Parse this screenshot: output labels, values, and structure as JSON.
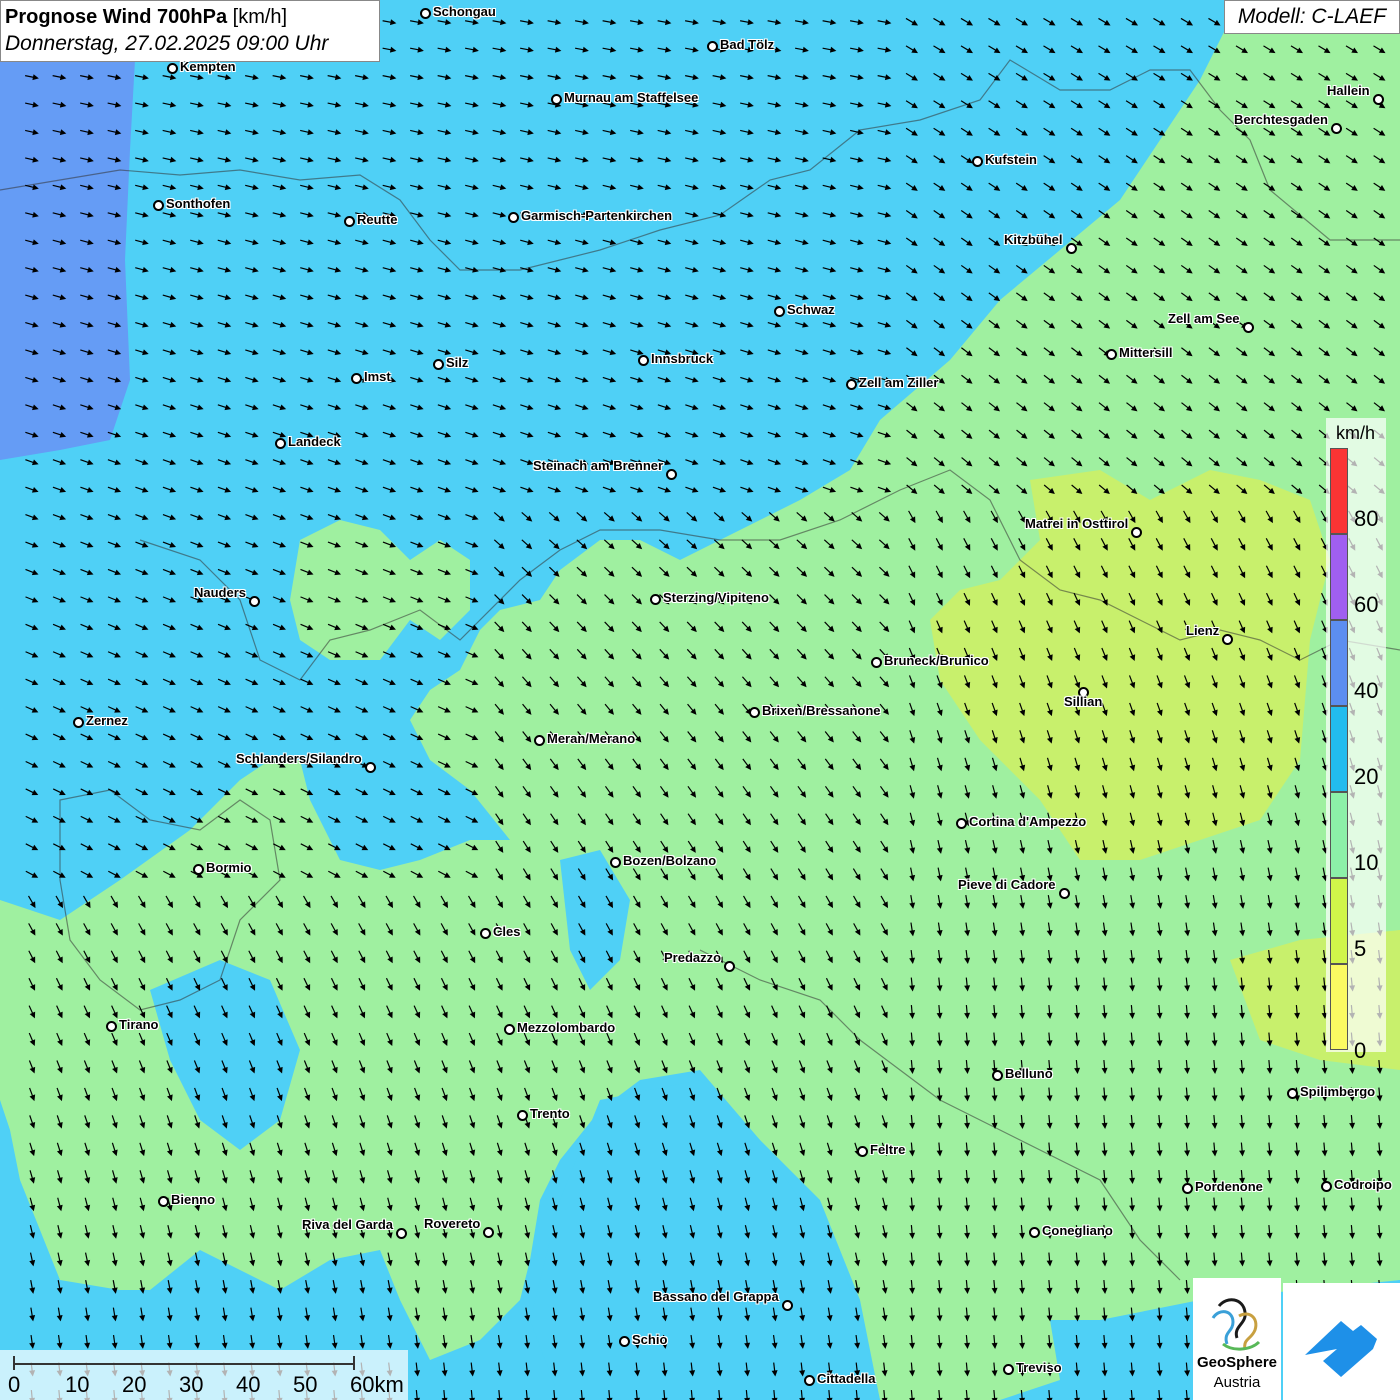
{
  "title": {
    "bold": "Prognose Wind 700hPa",
    "unit": "[km/h]",
    "datetime": "Donnerstag, 27.02.2025 09:00 Uhr"
  },
  "model": "Modell: C-LAEF",
  "legend": {
    "unit": "km/h",
    "ticks": [
      "80",
      "60",
      "40",
      "20",
      "10",
      "5",
      "0"
    ],
    "colors": [
      "#fa3434",
      "#a05ff0",
      "#5c8ef0",
      "#22bcee",
      "#8cf0a8",
      "#d0f54a",
      "#fafa62"
    ]
  },
  "scalebar": {
    "labels": [
      "0",
      "10",
      "20",
      "30",
      "40",
      "50",
      "60km"
    ]
  },
  "logo": {
    "name1": "GeoSphere",
    "name2": "Austria"
  },
  "colors": {
    "strong": "#4fd0f6",
    "medium": "#9ff0a0",
    "weak": "#c8f06c",
    "violet": "#6a8ef5"
  },
  "cities": [
    {
      "name": "Schongau"
    },
    {
      "name": "Bad Tölz"
    },
    {
      "name": "Kempten"
    },
    {
      "name": "Murnau am Staffelsee"
    },
    {
      "name": "Hallein"
    },
    {
      "name": "Berchtesgaden"
    },
    {
      "name": "Kufstein"
    },
    {
      "name": "Sonthofen"
    },
    {
      "name": "Reutte"
    },
    {
      "name": "Garmisch-Partenkirchen"
    },
    {
      "name": "Kitzbühel"
    },
    {
      "name": "Schwaz"
    },
    {
      "name": "Zell am See"
    },
    {
      "name": "Mittersill"
    },
    {
      "name": "Innsbruck"
    },
    {
      "name": "Silz"
    },
    {
      "name": "Imst"
    },
    {
      "name": "Zell am Ziller"
    },
    {
      "name": "Landeck"
    },
    {
      "name": "Steinach am Brenner"
    },
    {
      "name": "Matrei in Osttirol"
    },
    {
      "name": "Nauders"
    },
    {
      "name": "Sterzing/Vipiteno"
    },
    {
      "name": "Lienz"
    },
    {
      "name": "Bruneck/Brunico"
    },
    {
      "name": "Sillian"
    },
    {
      "name": "Brixen/Bressanone"
    },
    {
      "name": "Zernez"
    },
    {
      "name": "Meran/Merano"
    },
    {
      "name": "Schlanders/Silandro"
    },
    {
      "name": "Cortina d'Ampezzo"
    },
    {
      "name": "Bozen/Bolzano"
    },
    {
      "name": "Bormio"
    },
    {
      "name": "Pieve di Cadore"
    },
    {
      "name": "Cles"
    },
    {
      "name": "Predazzo"
    },
    {
      "name": "Tirano"
    },
    {
      "name": "Mezzolombardo"
    },
    {
      "name": "Belluno"
    },
    {
      "name": "Spilimbergo"
    },
    {
      "name": "Trento"
    },
    {
      "name": "Feltre"
    },
    {
      "name": "Pordenone"
    },
    {
      "name": "Codroipo"
    },
    {
      "name": "Bienno"
    },
    {
      "name": "Riva del Garda"
    },
    {
      "name": "Rovereto"
    },
    {
      "name": "Conegliano"
    },
    {
      "name": "Bassano del Grappa"
    },
    {
      "name": "Schio"
    },
    {
      "name": "Treviso"
    },
    {
      "name": "Cittadella"
    }
  ]
}
